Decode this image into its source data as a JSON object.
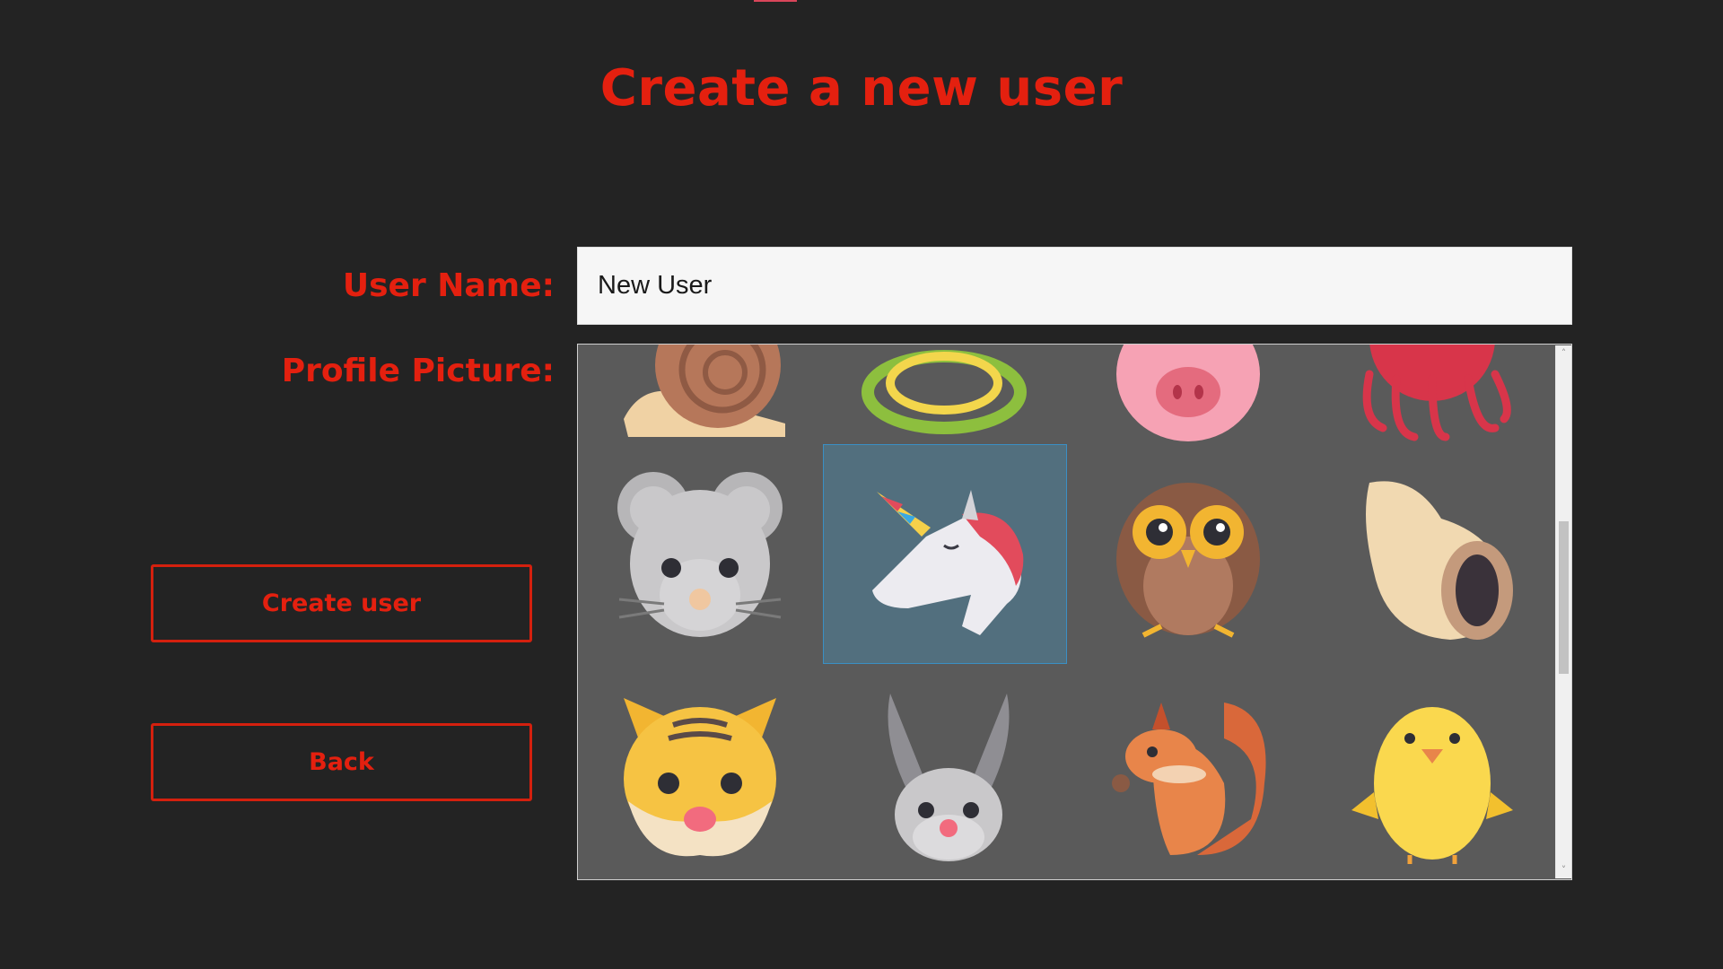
{
  "page": {
    "title": "Create a new user"
  },
  "form": {
    "user_name_label": "User Name:",
    "user_name_value": "New User",
    "profile_picture_label": "Profile Picture:"
  },
  "buttons": {
    "create_label": "Create user",
    "back_label": "Back"
  },
  "avatars": [
    {
      "name": "snail",
      "row": 0
    },
    {
      "name": "snake",
      "row": 0
    },
    {
      "name": "pig",
      "row": 0
    },
    {
      "name": "octopus",
      "row": 0
    },
    {
      "name": "mouse",
      "row": 1
    },
    {
      "name": "unicorn",
      "row": 1,
      "selected": true
    },
    {
      "name": "owl",
      "row": 1
    },
    {
      "name": "seashell",
      "row": 1
    },
    {
      "name": "tiger",
      "row": 2
    },
    {
      "name": "rabbit",
      "row": 2
    },
    {
      "name": "squirrel",
      "row": 2
    },
    {
      "name": "chick",
      "row": 2
    }
  ],
  "colors": {
    "accent": "#e4200f",
    "background": "#232323",
    "picker_background": "#5a5a5a",
    "selection": "#526f7e"
  }
}
